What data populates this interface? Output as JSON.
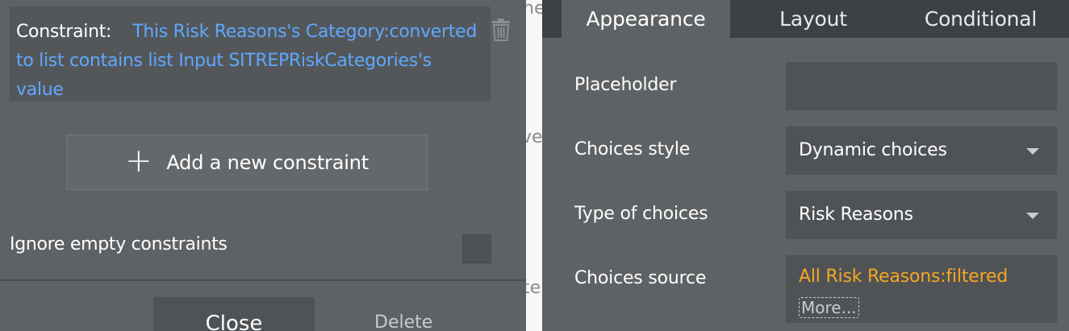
{
  "left_panel": {
    "constraint_label": "Constraint:",
    "constraint_expression": "This Risk Reasons's Category:converted to list contains list Input SITREPRiskCategories's value",
    "delete_constraint_icon": "trash-icon",
    "add_constraint_label": "Add a new constraint",
    "add_icon": "plus-icon",
    "ignore_empty_label": "Ignore empty constraints",
    "ignore_empty_checked": false,
    "close_label": "Close",
    "delete_label": "Delete"
  },
  "background_fragments": [
    "ne",
    "ve",
    "te"
  ],
  "right_panel": {
    "tabs": [
      {
        "label": "Appearance",
        "active": true
      },
      {
        "label": "Layout",
        "active": false
      },
      {
        "label": "Conditional",
        "active": false
      }
    ],
    "properties": [
      {
        "label": "Placeholder",
        "value": ""
      },
      {
        "label": "Choices style",
        "value": "Dynamic choices"
      },
      {
        "label": "Type of choices",
        "value": "Risk Reasons"
      },
      {
        "label": "Choices source",
        "value": "All Risk Reasons:filtered",
        "more_label": "More..."
      }
    ],
    "source_value_color": "#f5a623",
    "expression_color": "#5ea8ff"
  }
}
